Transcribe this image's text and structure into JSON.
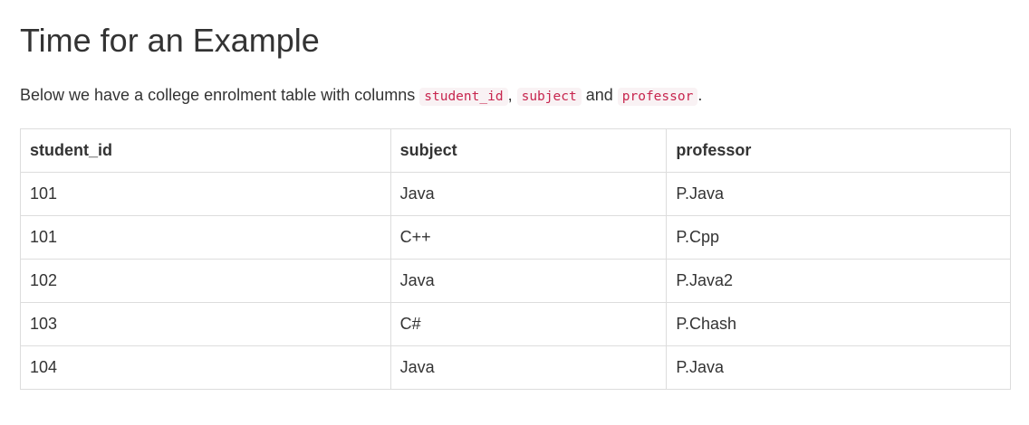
{
  "heading": "Time for an Example",
  "description": {
    "before": "Below we have a college enrolment table with columns ",
    "code1": "student_id",
    "sep": ",",
    "code2": "subject",
    "and": " and ",
    "code3": "professor",
    "end": "."
  },
  "table": {
    "headers": [
      "student_id",
      "subject",
      "professor"
    ],
    "rows": [
      [
        "101",
        "Java",
        "P.Java"
      ],
      [
        "101",
        "C++",
        "P.Cpp"
      ],
      [
        "102",
        "Java",
        "P.Java2"
      ],
      [
        "103",
        "C#",
        "P.Chash"
      ],
      [
        "104",
        "Java",
        "P.Java"
      ]
    ]
  },
  "colors": {
    "text": "#333333",
    "code_text": "#c7254e",
    "code_bg": "#f9f2f4",
    "border": "#dddddd"
  }
}
